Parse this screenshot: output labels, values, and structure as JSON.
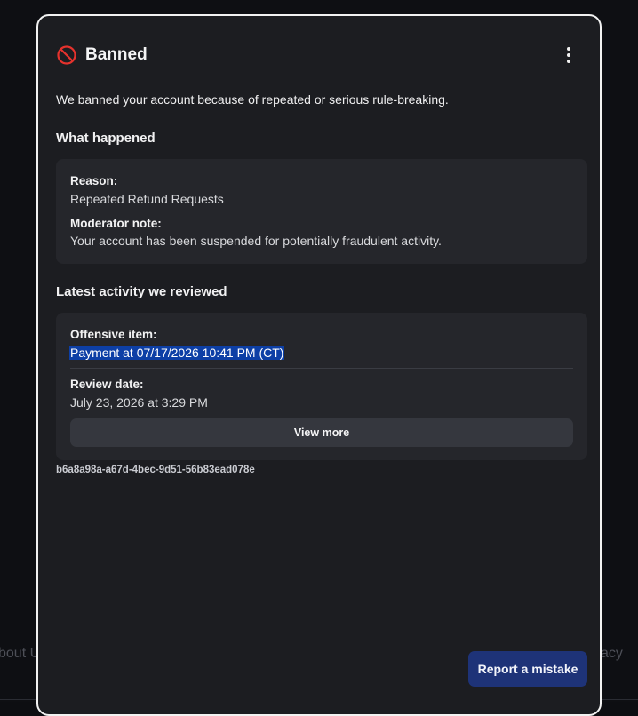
{
  "background": {
    "footer_left_text": "bout U",
    "footer_right_text": "acy"
  },
  "modal": {
    "title": "Banned",
    "title_icon": "ban-icon",
    "menu_icon": "more-vertical-icon",
    "description": "We banned your account because of repeated or serious rule-breaking.",
    "what_happened": {
      "heading": "What happened",
      "reason_label": "Reason:",
      "reason_value": "Repeated Refund Requests",
      "note_label": "Moderator note:",
      "note_value": "Your account has been suspended for potentially fraudulent activity."
    },
    "latest_activity": {
      "heading": "Latest activity we reviewed",
      "item_label": "Offensive item:",
      "item_value": "Payment at 07/17/2026 10:41 PM (CT)",
      "review_label": "Review date:",
      "review_value": "July 23, 2026 at 3:29 PM",
      "view_more_label": "View more"
    },
    "reference_id": "b6a8a98a-a67d-4bec-9d51-56b83ead078e",
    "report_button_label": "Report a mistake"
  },
  "colors": {
    "modal_bg": "#1c1d21",
    "card_bg": "#25262b",
    "accent_button": "#1e3378",
    "highlight": "#0d3fa6",
    "ban_icon": "#e5322d"
  }
}
